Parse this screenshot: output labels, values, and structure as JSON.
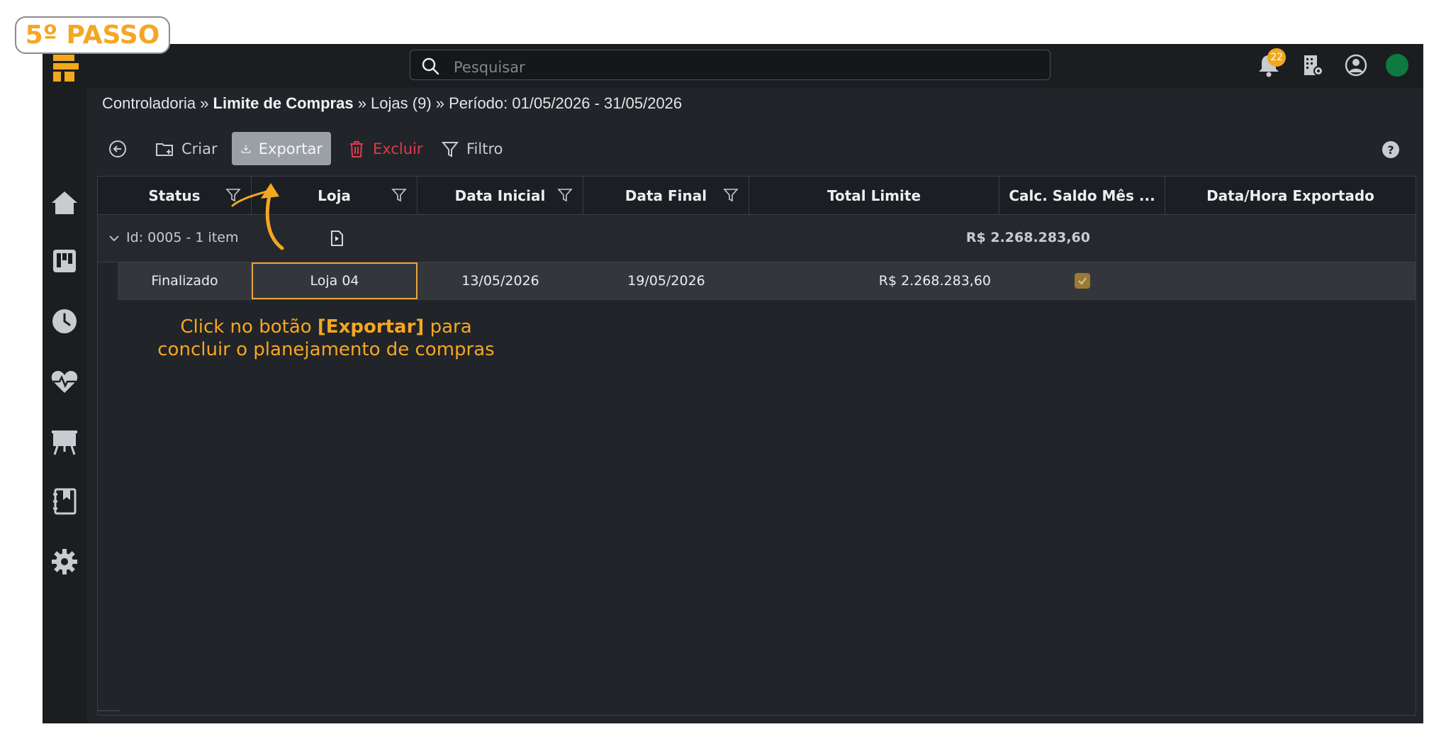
{
  "step_label": "5º PASSO",
  "search": {
    "placeholder": "Pesquisar"
  },
  "notifications": {
    "count": "22"
  },
  "breadcrumb": {
    "part1": "Controladoria » ",
    "part2": "Limite de Compras",
    "part3": " » Lojas (9) » Período: 01/05/2026 - 31/05/2026"
  },
  "toolbar": {
    "create_label": "Criar",
    "export_label": "Exportar",
    "delete_label": "Excluir",
    "filter_label": "Filtro"
  },
  "table": {
    "columns": [
      "Status",
      "Loja",
      "Data Inicial",
      "Data Final",
      "Total Limite",
      "Calc. Saldo Mês ...",
      "Data/Hora Exportado"
    ],
    "group": {
      "label": "Id: 0005 - 1 item",
      "total": "R$ 2.268.283,60"
    },
    "rows": [
      {
        "status": "Finalizado",
        "loja": "Loja 04",
        "data_inicial": "13/05/2026",
        "data_final": "19/05/2026",
        "total_limite": "R$ 2.268.283,60",
        "calc_saldo": true,
        "exportado": ""
      }
    ]
  },
  "annotation": {
    "prefix": "Click no botão ",
    "highlight": "[Exportar]",
    "suffix": " para",
    "line2": "concluir o planejamento de compras"
  },
  "colors": {
    "accent": "#f5a623",
    "danger": "#e23a4e",
    "status_online": "#0e7a3f"
  }
}
